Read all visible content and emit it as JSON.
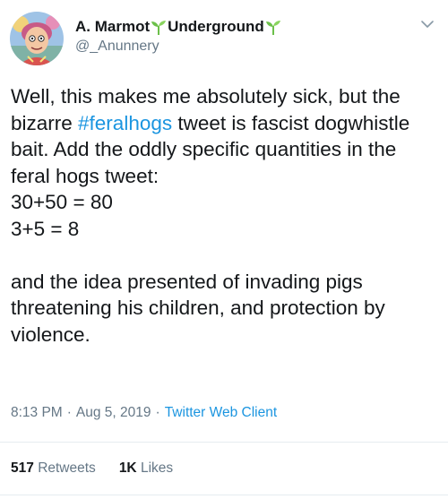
{
  "user": {
    "display_name_part1": "A. Marmot",
    "display_name_part2": "Underground",
    "handle": "@_Anunnery"
  },
  "tweet": {
    "line_1_before": "Well, this makes me absolutely sick, but the bizarre ",
    "hashtag": "#feralhogs",
    "line_1_after": " tweet is fascist dogwhistle bait. Add the oddly specific quantities in the feral hogs tweet:",
    "sum_1": "30+50 = 80",
    "sum_2": "3+5 = 8",
    "paragraph_2": "and the idea presented of invading pigs threatening his children, and protection by violence."
  },
  "meta": {
    "time": "8:13 PM",
    "separator": "·",
    "date": "Aug 5, 2019",
    "client": "Twitter Web Client"
  },
  "stats": {
    "retweets_count": "517",
    "retweets_label": "Retweets",
    "likes_count": "1K",
    "likes_label": "Likes"
  },
  "icons": {
    "sprout_color": "#6cc04a",
    "hashtag_color": "#1b95e0",
    "caret": "chevron-down-icon"
  }
}
